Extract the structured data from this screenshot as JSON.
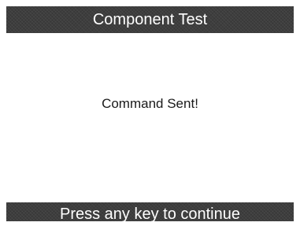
{
  "header": {
    "title": "Component Test"
  },
  "main": {
    "message": "Command Sent!"
  },
  "footer": {
    "prompt": "Press any key to continue"
  },
  "colors": {
    "bar_background": "#3e3e3e",
    "bar_text": "#ffffff",
    "content_background": "#ffffff",
    "content_text": "#1a1a1a"
  }
}
